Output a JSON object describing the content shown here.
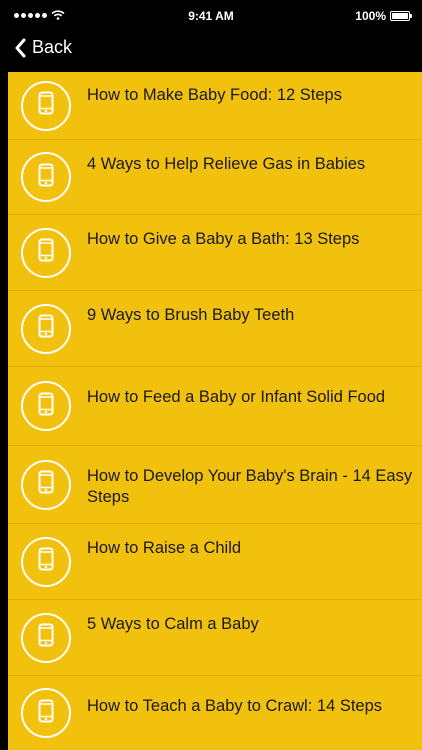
{
  "status_bar": {
    "time": "9:41 AM",
    "battery_label": "100%",
    "battery_level": 1.0
  },
  "nav": {
    "back_label": "Back"
  },
  "list": {
    "items": [
      {
        "title": "How to Make Baby Food: 12 Steps",
        "icon": "phone-icon"
      },
      {
        "title": "4 Ways to Help Relieve Gas in Babies",
        "icon": "phone-icon"
      },
      {
        "title": "How to Give a Baby a Bath: 13 Steps",
        "icon": "phone-icon"
      },
      {
        "title": "9 Ways to Brush Baby Teeth",
        "icon": "phone-icon"
      },
      {
        "title": "How to Feed a Baby or Infant Solid Food",
        "icon": "phone-icon"
      },
      {
        "title": "How to Develop Your Baby's Brain - 14 Easy Steps",
        "icon": "phone-icon"
      },
      {
        "title": "How to Raise a Child",
        "icon": "phone-icon"
      },
      {
        "title": "5 Ways to Calm a Baby",
        "icon": "phone-icon"
      },
      {
        "title": "How to Teach a Baby to Crawl: 14 Steps",
        "icon": "phone-icon"
      }
    ]
  },
  "colors": {
    "list_background": "#f2c10d",
    "bar_background": "#000000",
    "text": "#1a1a1a"
  }
}
